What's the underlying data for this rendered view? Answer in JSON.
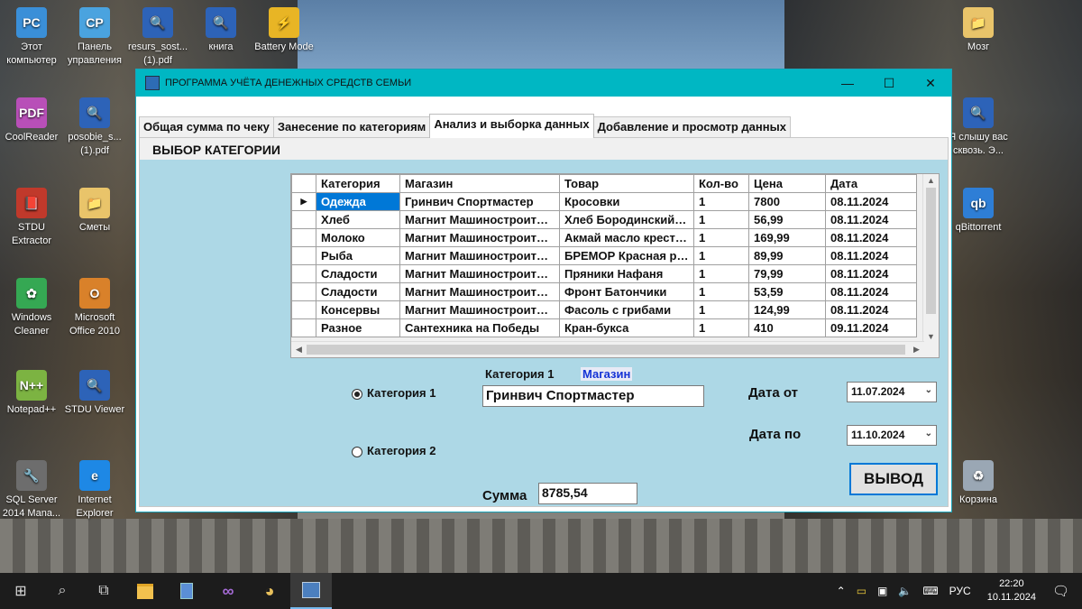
{
  "desktop": {
    "icons": [
      {
        "label": "Этот компьютер",
        "glyph": "PC",
        "color": "#3a8fd8"
      },
      {
        "label": "Панель управления",
        "glyph": "CP",
        "color": "#4aa3df"
      },
      {
        "label": "resurs_sost... (1).pdf",
        "glyph": "🔍",
        "color": "#2d63b8"
      },
      {
        "label": "книга",
        "glyph": "🔍",
        "color": "#2d63b8"
      },
      {
        "label": "Battery Mode",
        "glyph": "⚡",
        "color": "#e8b525"
      },
      {
        "label": "Мозг",
        "glyph": "📁",
        "color": "#e9c46a"
      },
      {
        "label": "CoolReader",
        "glyph": "PDF",
        "color": "#b84fb8"
      },
      {
        "label": "posobie_s... (1).pdf",
        "glyph": "🔍",
        "color": "#2d63b8"
      },
      {
        "label": "Я слышу вас сквозь. Э...",
        "glyph": "🔍",
        "color": "#2d63b8"
      },
      {
        "label": "STDU Extractor",
        "glyph": "📕",
        "color": "#c0392b"
      },
      {
        "label": "Сметы",
        "glyph": "📁",
        "color": "#e9c46a"
      },
      {
        "label": "qBittorrent",
        "glyph": "qb",
        "color": "#2e7ed6"
      },
      {
        "label": "Windows Cleaner",
        "glyph": "✿",
        "color": "#35a853"
      },
      {
        "label": "Microsoft Office 2010",
        "glyph": "O",
        "color": "#d9812a"
      },
      {
        "label": "Notepad++",
        "glyph": "N++",
        "color": "#7cb342"
      },
      {
        "label": "STDU Viewer",
        "glyph": "🔍",
        "color": "#2d63b8"
      },
      {
        "label": "SQL Server 2014 Mana...",
        "glyph": "🔧",
        "color": "#6d6d6d"
      },
      {
        "label": "Internet Explorer",
        "glyph": "e",
        "color": "#1e88e5"
      },
      {
        "label": "Корзина",
        "glyph": "♻",
        "color": "#9aa7b4"
      }
    ]
  },
  "window": {
    "title": "ПРОГРАММА УЧЁТА  ДЕНЕЖНЫХ СРЕДСТВ СЕМЬИ",
    "minimize": "—",
    "maximize": "☐",
    "close": "✕"
  },
  "tabs": [
    {
      "label": "Общая сумма по чеку",
      "active": false
    },
    {
      "label": "Занесение по категориям",
      "active": false
    },
    {
      "label": "Анализ и выборка данных",
      "active": true
    },
    {
      "label": "Добавление и просмотр данных",
      "active": false
    }
  ],
  "section_title": "ВЫБОР КАТЕГОРИИ",
  "grid": {
    "columns": [
      "Категория",
      "Магазин",
      "Товар",
      "Кол-во",
      "Цена",
      "Дата"
    ],
    "rows": [
      [
        "Одежда",
        "Гринвич Спортмастер",
        "Кросовки",
        "1",
        "7800",
        "08.11.2024"
      ],
      [
        "Хлеб",
        "Магнит Машиностроителей",
        "Хлеб Бородинский нарезка",
        "1",
        "56,99",
        "08.11.2024"
      ],
      [
        "Молоко",
        "Магнит Машиностроителей",
        "Акмай масло крестьянское",
        "1",
        "169,99",
        "08.11.2024"
      ],
      [
        "Рыба",
        "Магнит Машиностроителей",
        "БРЕМОР Красная рыба",
        "1",
        "89,99",
        "08.11.2024"
      ],
      [
        "Сладости",
        "Магнит Машиностроителей",
        "Пряники Нафаня",
        "1",
        "79,99",
        "08.11.2024"
      ],
      [
        "Сладости",
        "Магнит Машиностроителей",
        "Фронт Батончики",
        "1",
        "53,59",
        "08.11.2024"
      ],
      [
        "Консервы",
        "Магнит Машиностроителей",
        "Фасоль с грибами",
        "1",
        "124,99",
        "08.11.2024"
      ],
      [
        "Разное",
        "Сантехника на Победы",
        "Кран-букса",
        "1",
        "410",
        "09.11.2024"
      ]
    ],
    "row_indicator": "▶"
  },
  "filters": {
    "radio1_label": "Категория 1",
    "radio2_label": "Категория 2",
    "field_label": "Категория 1",
    "field_hint": "Магазин",
    "field_value": "Гринвич Спортмастер",
    "date_from_label": "Дата от",
    "date_from_value": "11.07.2024",
    "date_to_label": "Дата по",
    "date_to_value": "11.10.2024",
    "output_button": "ВЫВОД",
    "sum_label": "Сумма",
    "sum_value": "8785,54"
  },
  "taskbar": {
    "start": "⊞",
    "search": "⌕",
    "taskview": "⧉",
    "lang": "РУС",
    "time": "22:20",
    "date": "10.11.2024",
    "notifications": "🗨"
  }
}
